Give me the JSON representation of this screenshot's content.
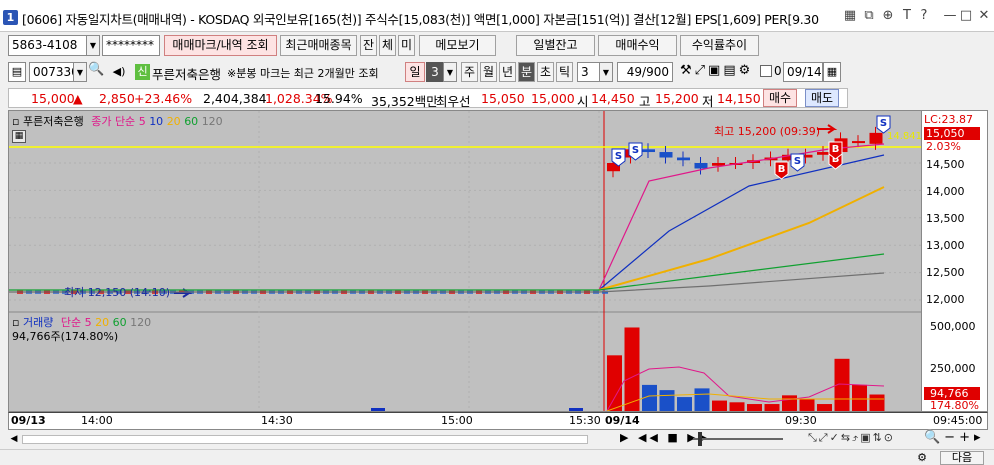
{
  "window": {
    "num": "1",
    "title": "[0606] 자동일지차트(매매내역) - KOSDAQ 외국인보유[165(천)] 주식수[15,083(천)] 액면[1,000] 자본금[151(억)] 결산[12월] EPS[1,609] PER[9.30"
  },
  "toolbar1": {
    "account": "5863-4108",
    "password": "********",
    "b_mark": "매매마크/내역 조회",
    "b_recent": "최근매매종목",
    "b_jan": "잔",
    "b_che": "체",
    "b_mi": "미",
    "b_memo": "메모보기",
    "b_daily": "일별잔고",
    "b_profit": "매매수익",
    "b_rate": "수익률추이"
  },
  "toolbar2": {
    "code": "007330",
    "new_badge": "신",
    "stock_name": "푸른저축은행",
    "notice": "※분봉 마크는 최근 2개월만 조회",
    "period_day": "일",
    "period_value": "3",
    "tabs": [
      "주",
      "월",
      "년",
      "분",
      "초",
      "틱"
    ],
    "unit": "3",
    "count": "49/900",
    "checkbox_label": "0",
    "date": "09/14"
  },
  "quote": {
    "price": "15,000",
    "arrow": "▲",
    "change": "2,850",
    "change_pct": "+23.46%",
    "volume": "2,404,384",
    "vol_ratio": "1,028.34%",
    "turnover": "15.94%",
    "amount": "35,352백만",
    "best_label": "최우선",
    "best_bid": "15,050",
    "best_ask": "15,000",
    "open_label": "시",
    "open": "14,450",
    "high_label": "고",
    "high": "15,200",
    "low_label": "저",
    "low": "14,150",
    "buy": "매수",
    "sell": "매도"
  },
  "price_panel": {
    "name": "푸른저축은행",
    "ma_label": "종가 단순",
    "ma": [
      "5",
      "10",
      "20",
      "60",
      "120"
    ],
    "ma_colors": [
      "#e0188a",
      "#1030c0",
      "#f0b000",
      "#10a030",
      "#777777"
    ],
    "high_note": "최고 15,200 (09:39)",
    "low_note": "최저 12,150 (14:10)",
    "lc": "LC:23.87",
    "ref_line": "14.841",
    "cur_price": "15,050",
    "cur_pct": "2.03%",
    "yticks": [
      "14,500",
      "14,000",
      "13,500",
      "13,000",
      "12,500",
      "12,000"
    ],
    "marks": [
      "S",
      "S",
      "B",
      "S",
      "B",
      "B",
      "S"
    ]
  },
  "volume_panel": {
    "name": "거래량",
    "ma_label": "단순",
    "ma": [
      "5",
      "20",
      "60",
      "120"
    ],
    "info": "94,766주(174.80%)",
    "yticks": [
      "500,000",
      "250,000"
    ],
    "cur": "94,766",
    "pct": "174.80%"
  },
  "xaxis": {
    "labels": [
      "09/13",
      "14:00",
      "14:30",
      "15:00",
      "15:30",
      "09/14",
      "09:30",
      "09:45:00"
    ]
  },
  "bottom": {
    "next": "다음"
  },
  "chart_data": {
    "type": "candlestick",
    "x": [
      "09:00",
      "09:03",
      "09:06",
      "09:09",
      "09:12",
      "09:15",
      "09:18",
      "09:21",
      "09:24",
      "09:27",
      "09:30",
      "09:33",
      "09:36",
      "09:39",
      "09:42",
      "09:45"
    ],
    "close": [
      14500,
      14750,
      14700,
      14600,
      14550,
      14400,
      14500,
      14500,
      14550,
      14600,
      14650,
      14650,
      14700,
      14950,
      14900,
      15050
    ],
    "volume": [
      320000,
      480000,
      150000,
      120000,
      80000,
      130000,
      60000,
      50000,
      40000,
      40000,
      90000,
      70000,
      40000,
      300000,
      150000,
      94766
    ]
  }
}
